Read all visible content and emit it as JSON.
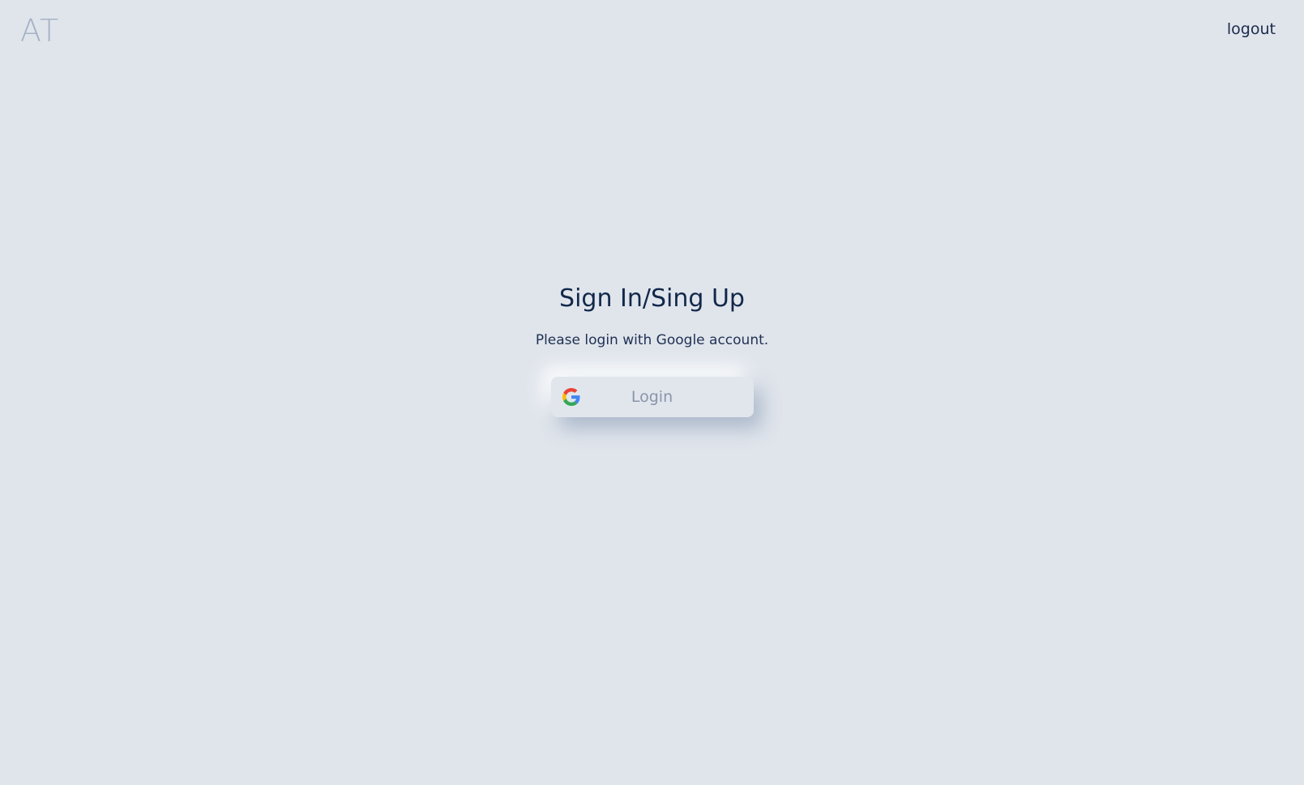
{
  "header": {
    "logo": "AT",
    "logout_label": "logout"
  },
  "main": {
    "title": "Sign In/Sing Up",
    "subtitle": "Please login with Google account.",
    "login_button_label": "Login",
    "login_button_icon": "google-icon"
  },
  "colors": {
    "background": "#e0e5ec",
    "title": "#12284a",
    "logo": "#a6b2c4",
    "button_text": "#8a95aa"
  }
}
